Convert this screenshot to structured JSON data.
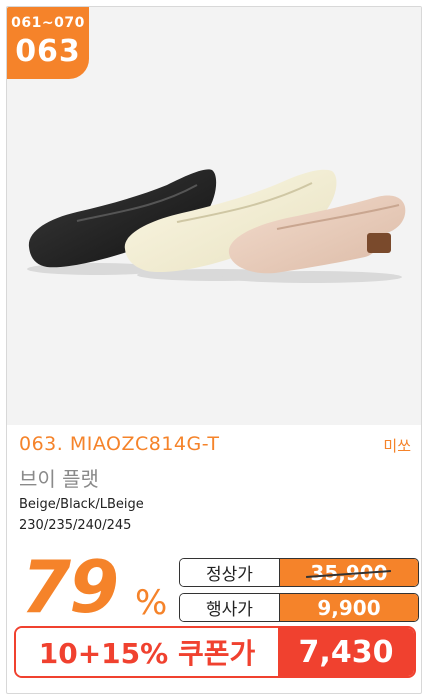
{
  "badge": {
    "range": "061~070",
    "number": "063"
  },
  "product": {
    "code": "063. MIAOZC814G-T",
    "brand": "미쏘",
    "name": "브이 플랫",
    "colors": "Beige/Black/LBeige",
    "sizes": "230/235/240/245"
  },
  "discount": {
    "value": "79",
    "unit": "%"
  },
  "prices": {
    "regular_label": "정상가",
    "regular_value": "35,900",
    "event_label": "행사가",
    "event_value": "9,900"
  },
  "coupon": {
    "label": "10+15% 쿠폰가",
    "value": "7,430"
  },
  "colors": {
    "accent": "#f5832a",
    "coupon_red": "#f0412f",
    "photo_bg": "#f3f3f3"
  }
}
